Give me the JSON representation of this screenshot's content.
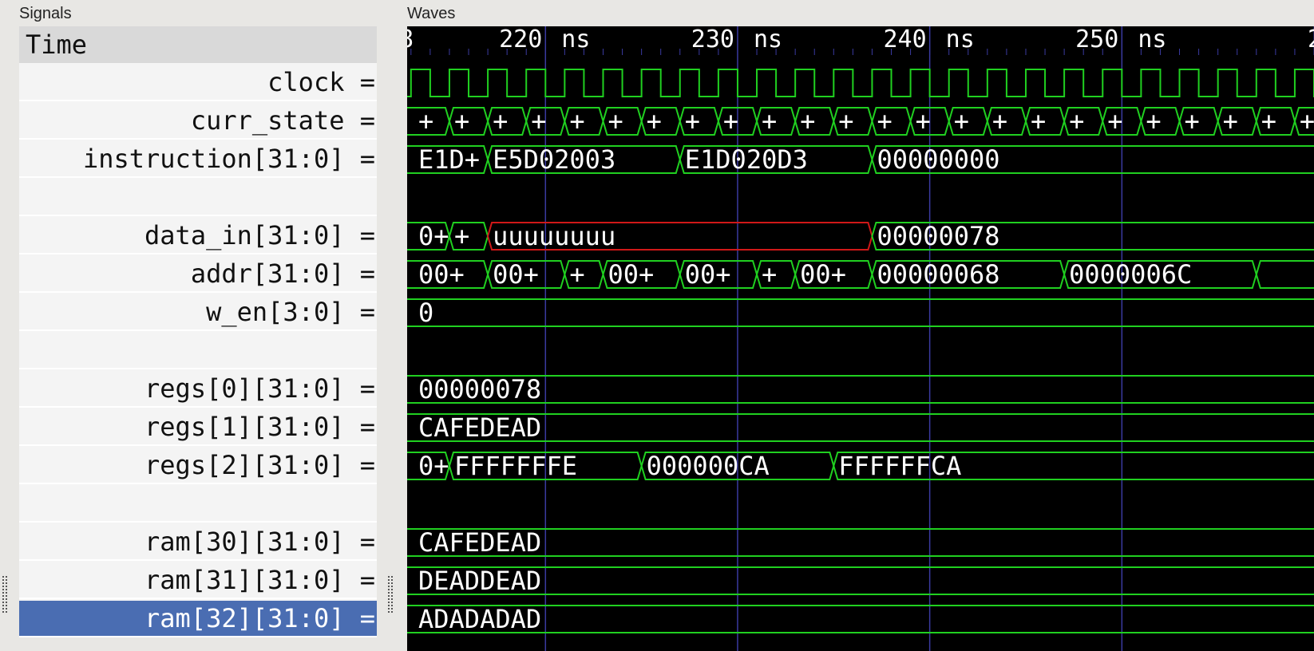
{
  "panes": {
    "signals_title": "Signals",
    "waves_title": "Waves"
  },
  "signals": {
    "time_label": "Time",
    "rows": [
      {
        "label": "clock =",
        "selected": false
      },
      {
        "label": "curr_state =",
        "selected": false
      },
      {
        "label": "instruction[31:0] =",
        "selected": false
      },
      {
        "label": "",
        "selected": false
      },
      {
        "label": "data_in[31:0] =",
        "selected": false
      },
      {
        "label": "addr[31:0] =",
        "selected": false
      },
      {
        "label": "w_en[3:0] =",
        "selected": false
      },
      {
        "label": "",
        "selected": false
      },
      {
        "label": "regs[0][31:0] =",
        "selected": false
      },
      {
        "label": "regs[1][31:0] =",
        "selected": false
      },
      {
        "label": "regs[2][31:0] =",
        "selected": false
      },
      {
        "label": "",
        "selected": false
      },
      {
        "label": "ram[30][31:0] =",
        "selected": false
      },
      {
        "label": "ram[31][31:0] =",
        "selected": false
      },
      {
        "label": "ram[32][31:0] =",
        "selected": true
      }
    ]
  },
  "waves": {
    "time_unit": "ns",
    "view_start": 212.8,
    "view_end": 260.0,
    "timeline": {
      "left_stub": "8",
      "right_stub": "2",
      "ticks": [
        220,
        230,
        240,
        250
      ],
      "tick_labels": [
        "220 ns",
        "230 ns",
        "240 ns",
        "250 ns"
      ]
    },
    "clock": {
      "period": 2.0,
      "first_rise": 213.0
    },
    "colors": {
      "trace": "#20d020",
      "undefined": "#d01818",
      "grid": "#3a3aa0",
      "text": "#ffffff"
    },
    "rows": [
      {
        "type": "clock"
      },
      {
        "type": "bus",
        "segments": [
          {
            "start": 212.8,
            "end": 215.0,
            "value": "+"
          },
          {
            "start": 215.0,
            "end": 217.0,
            "value": "+"
          },
          {
            "start": 217.0,
            "end": 219.0,
            "value": "+"
          },
          {
            "start": 219.0,
            "end": 221.0,
            "value": "+"
          },
          {
            "start": 221.0,
            "end": 223.0,
            "value": "+"
          },
          {
            "start": 223.0,
            "end": 225.0,
            "value": "+"
          },
          {
            "start": 225.0,
            "end": 227.0,
            "value": "+"
          },
          {
            "start": 227.0,
            "end": 229.0,
            "value": "+"
          },
          {
            "start": 229.0,
            "end": 231.0,
            "value": "+"
          },
          {
            "start": 231.0,
            "end": 233.0,
            "value": "+"
          },
          {
            "start": 233.0,
            "end": 235.0,
            "value": "+"
          },
          {
            "start": 235.0,
            "end": 237.0,
            "value": "+"
          },
          {
            "start": 237.0,
            "end": 239.0,
            "value": "+"
          },
          {
            "start": 239.0,
            "end": 241.0,
            "value": "+"
          },
          {
            "start": 241.0,
            "end": 243.0,
            "value": "+"
          },
          {
            "start": 243.0,
            "end": 245.0,
            "value": "+"
          },
          {
            "start": 245.0,
            "end": 247.0,
            "value": "+"
          },
          {
            "start": 247.0,
            "end": 249.0,
            "value": "+"
          },
          {
            "start": 249.0,
            "end": 251.0,
            "value": "+"
          },
          {
            "start": 251.0,
            "end": 253.0,
            "value": "+"
          },
          {
            "start": 253.0,
            "end": 255.0,
            "value": "+"
          },
          {
            "start": 255.0,
            "end": 257.0,
            "value": "+"
          },
          {
            "start": 257.0,
            "end": 259.0,
            "value": "+"
          },
          {
            "start": 259.0,
            "end": 261.0,
            "value": "+"
          }
        ]
      },
      {
        "type": "bus",
        "segments": [
          {
            "start": 212.8,
            "end": 217.0,
            "value": "E1D+"
          },
          {
            "start": 217.0,
            "end": 227.0,
            "value": "E5D02003"
          },
          {
            "start": 227.0,
            "end": 237.0,
            "value": "E1D020D3"
          },
          {
            "start": 237.0,
            "end": 261.0,
            "value": "00000000"
          }
        ]
      },
      {
        "type": "blank"
      },
      {
        "type": "bus",
        "segments": [
          {
            "start": 212.8,
            "end": 215.0,
            "value": "0+"
          },
          {
            "start": 215.0,
            "end": 217.0,
            "value": "+"
          },
          {
            "start": 217.0,
            "end": 237.0,
            "value": "uuuuuuuu",
            "undefined": true
          },
          {
            "start": 237.0,
            "end": 261.0,
            "value": "00000078"
          }
        ]
      },
      {
        "type": "bus",
        "segments": [
          {
            "start": 212.8,
            "end": 217.0,
            "value": "00+"
          },
          {
            "start": 217.0,
            "end": 221.0,
            "value": "00+"
          },
          {
            "start": 221.0,
            "end": 223.0,
            "value": "+"
          },
          {
            "start": 223.0,
            "end": 227.0,
            "value": "00+"
          },
          {
            "start": 227.0,
            "end": 231.0,
            "value": "00+"
          },
          {
            "start": 231.0,
            "end": 233.0,
            "value": "+"
          },
          {
            "start": 233.0,
            "end": 237.0,
            "value": "00+"
          },
          {
            "start": 237.0,
            "end": 247.0,
            "value": "00000068"
          },
          {
            "start": 247.0,
            "end": 257.0,
            "value": "0000006C"
          },
          {
            "start": 257.0,
            "end": 261.0,
            "value": ""
          }
        ]
      },
      {
        "type": "bus",
        "segments": [
          {
            "start": 212.8,
            "end": 261.0,
            "value": "0"
          }
        ]
      },
      {
        "type": "blank"
      },
      {
        "type": "bus",
        "segments": [
          {
            "start": 212.8,
            "end": 261.0,
            "value": "00000078"
          }
        ]
      },
      {
        "type": "bus",
        "segments": [
          {
            "start": 212.8,
            "end": 261.0,
            "value": "CAFEDEAD"
          }
        ]
      },
      {
        "type": "bus",
        "segments": [
          {
            "start": 212.8,
            "end": 215.0,
            "value": "0+"
          },
          {
            "start": 215.0,
            "end": 225.0,
            "value": "FFFFFFFE"
          },
          {
            "start": 225.0,
            "end": 235.0,
            "value": "000000CA"
          },
          {
            "start": 235.0,
            "end": 261.0,
            "value": "FFFFFFCA"
          }
        ]
      },
      {
        "type": "blank"
      },
      {
        "type": "bus",
        "segments": [
          {
            "start": 212.8,
            "end": 261.0,
            "value": "CAFEDEAD"
          }
        ]
      },
      {
        "type": "bus",
        "segments": [
          {
            "start": 212.8,
            "end": 261.0,
            "value": "DEADDEAD"
          }
        ]
      },
      {
        "type": "bus",
        "segments": [
          {
            "start": 212.8,
            "end": 261.0,
            "value": "ADADADAD"
          }
        ]
      }
    ]
  }
}
